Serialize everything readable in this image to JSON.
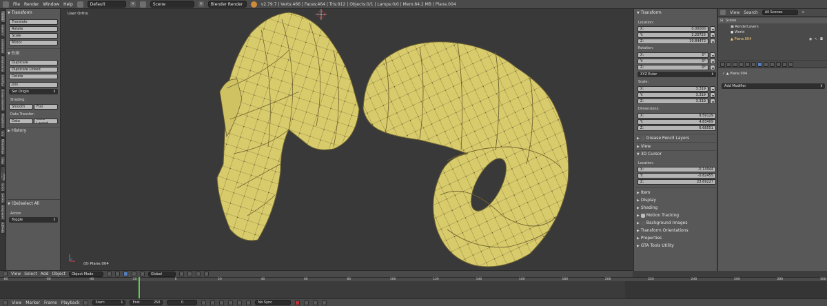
{
  "topbar": {
    "menus": [
      "File",
      "Render",
      "Window",
      "Help"
    ],
    "layout": "Default",
    "scene": "Scene",
    "engine": "Blender Render",
    "stats": "v2.79.7 | Verts:466 | Faces:464 | Tris:912 | Objects:0/1 | Lamps:0/0 | Mem:84.2 MB | Plane.004"
  },
  "left_tabs": [
    "Tools",
    "Create",
    "Relations",
    "Animation",
    "Physics",
    "Grease Pencil",
    "Sculpting",
    "UV",
    "Retopology",
    "Misc",
    "Paper Nest",
    "ESTO",
    "AGGRO",
    "Selection",
    "Weight"
  ],
  "shelf": {
    "transform": {
      "title": "Transform",
      "buttons": [
        "Translate",
        "Rotate",
        "Scale",
        "Mirror"
      ]
    },
    "edit": {
      "title": "Edit",
      "buttons": [
        "Duplicate",
        "Duplicate Linked",
        "Delete",
        "Join"
      ],
      "set_origin": "Set Origin",
      "shading_label": "Shading:",
      "smooth": "Smooth",
      "flat": "Flat",
      "data_transfer_label": "Data Transfer:",
      "data": "Data",
      "data_layout": "Data Layout"
    },
    "history": {
      "title": "History"
    },
    "op": {
      "title": "(De)select All",
      "action_label": "Action",
      "action_value": "Toggle"
    }
  },
  "viewport": {
    "view_label": "User Ortho",
    "object_label": "(0) Plane.004",
    "mesh_color": "#d8cb6c"
  },
  "npanel": {
    "transform_title": "Transform",
    "location_label": "Location:",
    "location": [
      {
        "axis": "X:",
        "value": "0.00000"
      },
      {
        "axis": "Y:",
        "value": "2.20723"
      },
      {
        "axis": "Z:",
        "value": "19.84472"
      }
    ],
    "rotation_label": "Rotation:",
    "rotation": [
      {
        "axis": "X:",
        "value": "0°"
      },
      {
        "axis": "Y:",
        "value": "0°"
      },
      {
        "axis": "Z:",
        "value": "0°"
      }
    ],
    "rotation_mode": "XYZ Euler",
    "scale_label": "Scale:",
    "scale": [
      {
        "axis": "X:",
        "value": "3.319"
      },
      {
        "axis": "Y:",
        "value": "3.319"
      },
      {
        "axis": "Z:",
        "value": "3.319"
      }
    ],
    "dimensions_label": "Dimensions:",
    "dimensions": [
      {
        "axis": "X:",
        "value": "9.59129"
      },
      {
        "axis": "Y:",
        "value": "4.83409"
      },
      {
        "axis": "Z:",
        "value": "6.68551"
      }
    ],
    "grease_pencil": "Grease Pencil Layers",
    "view": "View",
    "cursor_title": "3D Cursor",
    "cursor_location_label": "Location:",
    "cursor": [
      {
        "axis": "X:",
        "value": "-0.14944"
      },
      {
        "axis": "Y:",
        "value": "-0.82455"
      },
      {
        "axis": "Z:",
        "value": "23.69227"
      }
    ],
    "collapsed": [
      "Item",
      "Display",
      "Shading",
      "Motion Tracking",
      "Background Images",
      "Transform Orientations",
      "Properties",
      "GTA Tools Utility"
    ]
  },
  "outliner": {
    "view": "View",
    "search": "Search",
    "filter": "All Scenes",
    "items": [
      "Scene",
      "RenderLayers",
      "World",
      "Plane.004"
    ]
  },
  "properties": {
    "object": "Plane.004",
    "add_modifier": "Add Modifier"
  },
  "view3d_header": {
    "menus": [
      "View",
      "Select",
      "Add",
      "Object"
    ],
    "mode": "Object Mode",
    "orientation": "Global"
  },
  "timeline": {
    "ruler": [
      "-80",
      "-60",
      "-40",
      "-20",
      "0",
      "20",
      "40",
      "60",
      "80",
      "100",
      "120",
      "140",
      "160",
      "180",
      "200",
      "220",
      "240",
      "260",
      "280",
      "300"
    ],
    "menus": [
      "View",
      "Marker",
      "Frame",
      "Playback"
    ],
    "start_label": "Start:",
    "start": "1",
    "end_label": "End:",
    "end": "250",
    "current": "0",
    "sync": "No Sync"
  }
}
